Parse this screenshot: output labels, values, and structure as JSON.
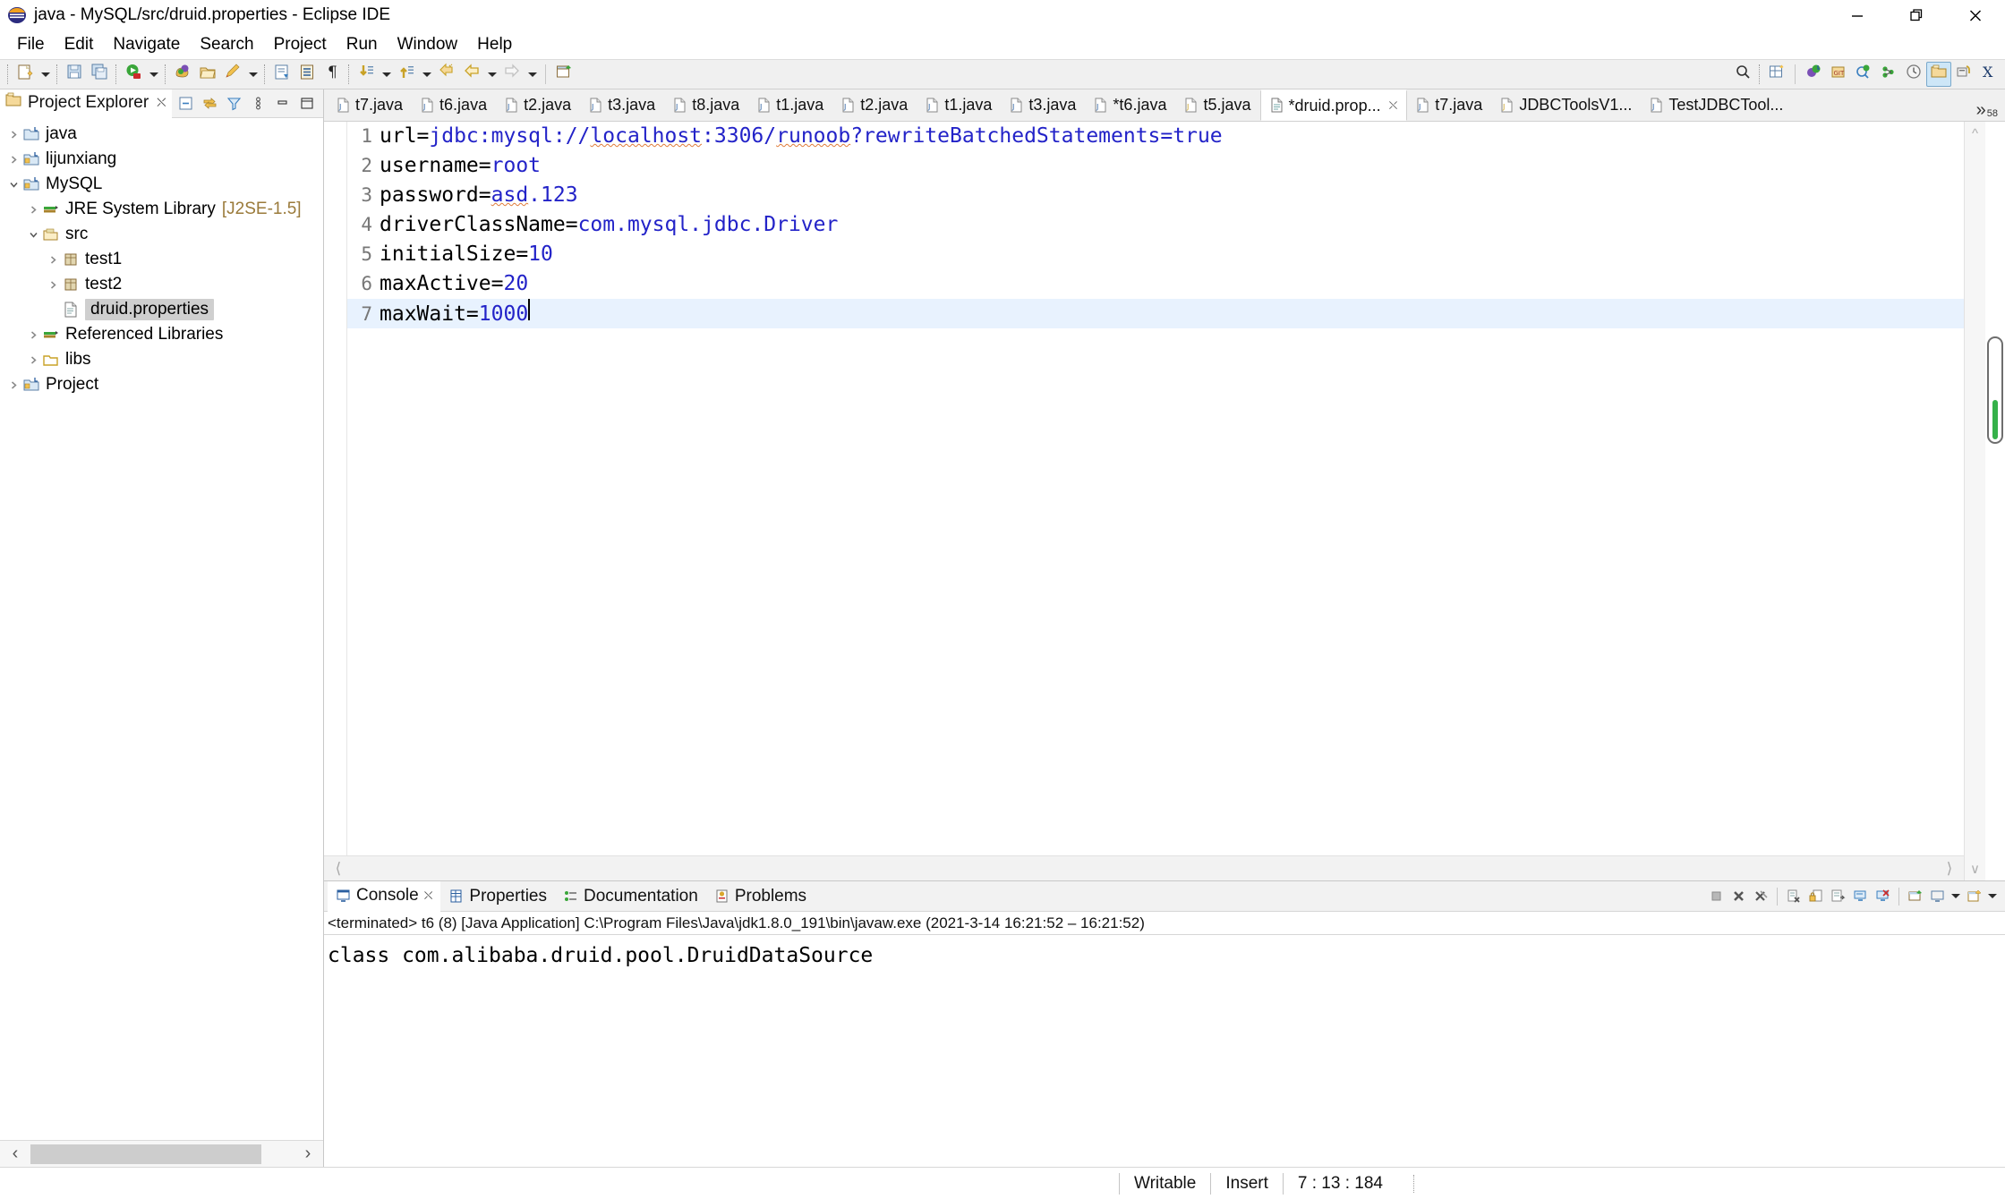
{
  "window": {
    "title": "java - MySQL/src/druid.properties - Eclipse IDE",
    "logo_icon": "eclipse-logo-icon",
    "controls": [
      {
        "name": "minimize-button",
        "icon": "minimize-icon"
      },
      {
        "name": "restore-button",
        "icon": "restore-icon"
      },
      {
        "name": "close-button",
        "icon": "close-icon"
      }
    ]
  },
  "menubar": {
    "items": [
      {
        "label": "File"
      },
      {
        "label": "Edit"
      },
      {
        "label": "Navigate"
      },
      {
        "label": "Search"
      },
      {
        "label": "Project"
      },
      {
        "label": "Run"
      },
      {
        "label": "Window"
      },
      {
        "label": "Help"
      }
    ]
  },
  "toolbar": {
    "buttons": [
      {
        "name": "new-wizard-button",
        "icon": "new-file-icon"
      },
      {
        "name": "new-dropdown",
        "icon": "chevron-down-icon"
      },
      {
        "name": "save-button",
        "icon": "save-icon"
      },
      {
        "name": "save-all-button",
        "icon": "save-all-icon"
      },
      {
        "name": "run-button",
        "icon": "run-green-play-icon"
      },
      {
        "name": "run-dropdown",
        "icon": "chevron-down-icon"
      },
      {
        "name": "debug-button",
        "icon": "debug-bug-icon"
      },
      {
        "name": "open-resource-button",
        "icon": "open-folder-icon"
      },
      {
        "name": "external-tools-button",
        "icon": "pencil-icon"
      },
      {
        "name": "external-tools-dropdown",
        "icon": "chevron-down-icon"
      },
      {
        "name": "new-java-class-button",
        "icon": "java-class-icon"
      },
      {
        "name": "open-type-button",
        "icon": "open-type-icon"
      },
      {
        "name": "toggle-mark-occurrences-button",
        "icon": "pilcrow-icon"
      },
      {
        "name": "next-annotation-button",
        "icon": "next-annotation-icon"
      },
      {
        "name": "next-annotation-dropdown",
        "icon": "chevron-down-icon"
      },
      {
        "name": "previous-annotation-button",
        "icon": "previous-annotation-icon"
      },
      {
        "name": "previous-annotation-dropdown",
        "icon": "chevron-down-icon"
      },
      {
        "name": "last-edit-location-button",
        "icon": "last-edit-location-icon"
      },
      {
        "name": "back-button",
        "icon": "back-arrow-icon"
      },
      {
        "name": "back-dropdown",
        "icon": "chevron-down-icon"
      },
      {
        "name": "forward-button",
        "icon": "forward-arrow-icon"
      },
      {
        "name": "forward-dropdown",
        "icon": "chevron-down-icon"
      },
      {
        "name": "new-window-button",
        "icon": "new-window-icon"
      }
    ],
    "right_buttons": [
      {
        "name": "search-button",
        "icon": "search-icon"
      },
      {
        "name": "open-perspective-button",
        "icon": "open-perspective-icon"
      },
      {
        "name": "java-perspective-button",
        "icon": "java-perspective-icon"
      },
      {
        "name": "git-perspective-button",
        "icon": "git-perspective-icon"
      },
      {
        "name": "debug-perspective-button",
        "icon": "debug-perspective-icon"
      },
      {
        "name": "java-browsing-perspective-button",
        "icon": "java-browsing-icon"
      },
      {
        "name": "history-perspective-button",
        "icon": "clock-icon"
      },
      {
        "name": "resource-perspective-button",
        "icon": "resource-folder-icon",
        "selected": true
      },
      {
        "name": "java-ee-perspective-button",
        "icon": "java-ee-icon"
      },
      {
        "name": "xml-perspective-button",
        "icon": "xml-x-icon"
      }
    ]
  },
  "explorer": {
    "tab_label": "Project Explorer",
    "tab_icon": "project-explorer-icon",
    "close_icon": "close-icon",
    "tools": [
      {
        "name": "collapse-all-button",
        "icon": "collapse-all-icon"
      },
      {
        "name": "link-with-editor-button",
        "icon": "link-editor-icon"
      },
      {
        "name": "view-menu-filter-button",
        "icon": "filter-icon"
      },
      {
        "name": "view-menu-button",
        "icon": "view-menu-icon"
      },
      {
        "name": "minimize-view-button",
        "icon": "minimize-icon"
      },
      {
        "name": "maximize-view-button",
        "icon": "maximize-icon"
      }
    ],
    "tree": [
      {
        "label": "java",
        "icon": "java-project-icon",
        "indent": 0,
        "state": "collapsed"
      },
      {
        "label": "lijunxiang",
        "icon": "java-project-icon",
        "indent": 0,
        "state": "collapsed"
      },
      {
        "label": "MySQL",
        "icon": "java-project-icon",
        "indent": 0,
        "state": "expanded"
      },
      {
        "label": "JRE System Library",
        "suffix": "[J2SE-1.5]",
        "icon": "jre-library-icon",
        "indent": 1,
        "state": "collapsed"
      },
      {
        "label": "src",
        "icon": "source-folder-icon",
        "indent": 1,
        "state": "expanded"
      },
      {
        "label": "test1",
        "icon": "package-icon",
        "indent": 2,
        "state": "collapsed"
      },
      {
        "label": "test2",
        "icon": "package-icon",
        "indent": 2,
        "state": "collapsed"
      },
      {
        "label": "druid.properties",
        "icon": "file-icon",
        "indent": 2,
        "state": "leaf",
        "selected": true
      },
      {
        "label": "Referenced Libraries",
        "icon": "jre-library-icon",
        "indent": 1,
        "state": "collapsed"
      },
      {
        "label": "libs",
        "icon": "folder-icon",
        "indent": 1,
        "state": "collapsed"
      },
      {
        "label": "Project",
        "icon": "java-project-icon",
        "indent": 0,
        "state": "collapsed"
      }
    ],
    "hscroll": {
      "left_icon": "chevron-left-icon",
      "right_icon": "chevron-right-icon"
    }
  },
  "editor": {
    "tabs": [
      {
        "label": "t7.java",
        "icon": "java-file-icon",
        "active": false
      },
      {
        "label": "t6.java",
        "icon": "java-file-icon",
        "active": false
      },
      {
        "label": "t2.java",
        "icon": "java-file-icon",
        "active": false
      },
      {
        "label": "t3.java",
        "icon": "java-file-icon",
        "active": false
      },
      {
        "label": "t8.java",
        "icon": "java-file-icon",
        "active": false
      },
      {
        "label": "t1.java",
        "icon": "java-file-icon",
        "active": false
      },
      {
        "label": "t2.java",
        "icon": "java-file-icon",
        "active": false
      },
      {
        "label": "t1.java",
        "icon": "java-file-icon",
        "active": false
      },
      {
        "label": "t3.java",
        "icon": "java-file-icon",
        "active": false
      },
      {
        "label": "*t6.java",
        "icon": "java-file-icon",
        "active": false
      },
      {
        "label": "t5.java",
        "icon": "java-file-icon",
        "active": false
      },
      {
        "label": "*druid.prop...",
        "icon": "properties-file-icon",
        "active": true,
        "close_icon": "close-icon"
      },
      {
        "label": "t7.java",
        "icon": "java-file-icon",
        "active": false
      },
      {
        "label": "JDBCToolsV1...",
        "icon": "java-file-icon",
        "active": false
      },
      {
        "label": "TestJDBCTool...",
        "icon": "java-file-icon",
        "active": false
      }
    ],
    "overflow": {
      "chevron": "»",
      "count": "58"
    },
    "lines": [
      {
        "num": "1",
        "key": "url=",
        "segments": [
          {
            "text": "jdbc:mysql://",
            "cls": "val"
          },
          {
            "text": "localhost",
            "cls": "val sq"
          },
          {
            "text": ":3306/",
            "cls": "val"
          },
          {
            "text": "runoob",
            "cls": "val sq"
          },
          {
            "text": "?rewriteBatchedStatements=true",
            "cls": "val"
          }
        ]
      },
      {
        "num": "2",
        "key": "username=",
        "segments": [
          {
            "text": "root",
            "cls": "val"
          }
        ]
      },
      {
        "num": "3",
        "key": "password=",
        "segments": [
          {
            "text": "asd",
            "cls": "val sq"
          },
          {
            "text": ".123",
            "cls": "val"
          }
        ]
      },
      {
        "num": "4",
        "key": "driverClassName=",
        "segments": [
          {
            "text": "com.mysql.jdbc.Driver",
            "cls": "val"
          }
        ]
      },
      {
        "num": "5",
        "key": "initialSize=",
        "segments": [
          {
            "text": "10",
            "cls": "val"
          }
        ]
      },
      {
        "num": "6",
        "key": "maxActive=",
        "segments": [
          {
            "text": "20",
            "cls": "val"
          }
        ]
      },
      {
        "num": "7",
        "key": "maxWait=",
        "segments": [
          {
            "text": "1000",
            "cls": "val"
          }
        ],
        "current": true,
        "caret": true
      }
    ],
    "hscroll": {
      "left_icon": "chevron-left-icon",
      "right_icon": "chevron-right-icon"
    },
    "ruler": {
      "up_icon": "chevron-up-icon",
      "down_icon": "chevron-down-icon",
      "marker_color": "#35b14a"
    }
  },
  "console": {
    "tabs": [
      {
        "label": "Console",
        "icon": "console-icon",
        "active": true,
        "close_icon": "close-icon"
      },
      {
        "label": "Properties",
        "icon": "properties-icon",
        "active": false
      },
      {
        "label": "Documentation",
        "icon": "documentation-icon",
        "active": false
      },
      {
        "label": "Problems",
        "icon": "problems-icon",
        "active": false
      }
    ],
    "tools": [
      {
        "name": "terminate-button",
        "icon": "terminate-stop-icon"
      },
      {
        "name": "remove-launch-button",
        "icon": "remove-x-icon"
      },
      {
        "name": "remove-all-terminated-button",
        "icon": "remove-all-x-icon"
      },
      {
        "name": "clear-console-button",
        "icon": "clear-console-icon"
      },
      {
        "name": "scroll-lock-button",
        "icon": "scroll-lock-icon"
      },
      {
        "name": "word-wrap-button",
        "icon": "word-wrap-icon"
      },
      {
        "name": "show-console-on-output-button",
        "icon": "show-console-icon"
      },
      {
        "name": "show-console-on-error-button",
        "icon": "show-console-error-icon"
      },
      {
        "name": "pin-console-button",
        "icon": "pin-console-icon"
      },
      {
        "name": "display-selected-console-button",
        "icon": "display-console-icon"
      },
      {
        "name": "display-selected-console-dropdown",
        "icon": "chevron-down-icon"
      },
      {
        "name": "open-console-button",
        "icon": "open-console-icon"
      },
      {
        "name": "open-console-dropdown",
        "icon": "chevron-down-icon"
      }
    ],
    "status_line": "<terminated> t6 (8) [Java Application] C:\\Program Files\\Java\\jdk1.8.0_191\\bin\\javaw.exe  (2021-3-14 16:21:52 – 16:21:52)",
    "output": "class com.alibaba.druid.pool.DruidDataSource"
  },
  "statusbar": {
    "writable": "Writable",
    "insert": "Insert",
    "position": "7 : 13 : 184"
  }
}
